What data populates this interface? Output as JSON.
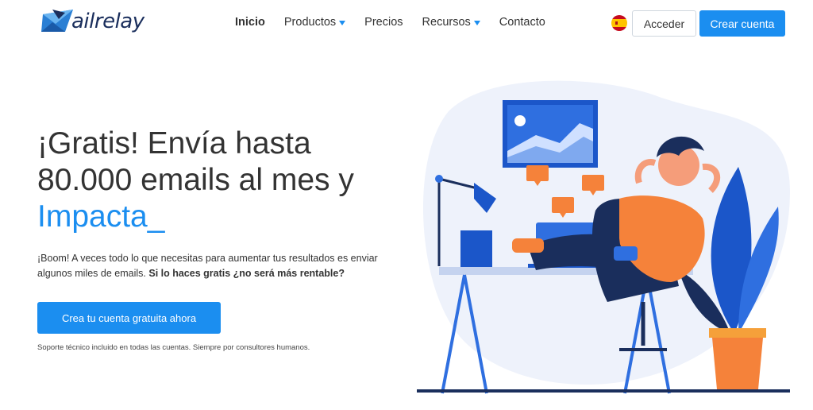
{
  "brand": {
    "name": "ailrelay",
    "logo_icon": "mail-envelope-icon"
  },
  "nav": {
    "items": [
      {
        "label": "Inicio",
        "active": true,
        "has_dropdown": false
      },
      {
        "label": "Productos",
        "active": false,
        "has_dropdown": true
      },
      {
        "label": "Precios",
        "active": false,
        "has_dropdown": false
      },
      {
        "label": "Recursos",
        "active": false,
        "has_dropdown": true
      },
      {
        "label": "Contacto",
        "active": false,
        "has_dropdown": false
      }
    ],
    "language_flag": "spain-flag-icon",
    "login_label": "Acceder",
    "signup_label": "Crear cuenta"
  },
  "hero": {
    "headline_line1": "¡Gratis! Envía hasta",
    "headline_line2": "80.000 emails al mes y",
    "headline_accent": "Impacta_",
    "description_plain": "¡Boom! A veces todo lo que necesitas para aumentar tus resultados es enviar algunos miles de emails. ",
    "description_bold": "Si lo haces gratis ¿no será más rentable?",
    "cta_label": "Crea tu cuenta gratuita ahora",
    "support_note": "Soporte técnico incluido en todas las cuentas. Siempre por consultores humanos."
  },
  "colors": {
    "accent": "#1b8ef0",
    "text": "#333333",
    "illustration_orange": "#f5823a",
    "illustration_navy": "#1a2e5c"
  }
}
